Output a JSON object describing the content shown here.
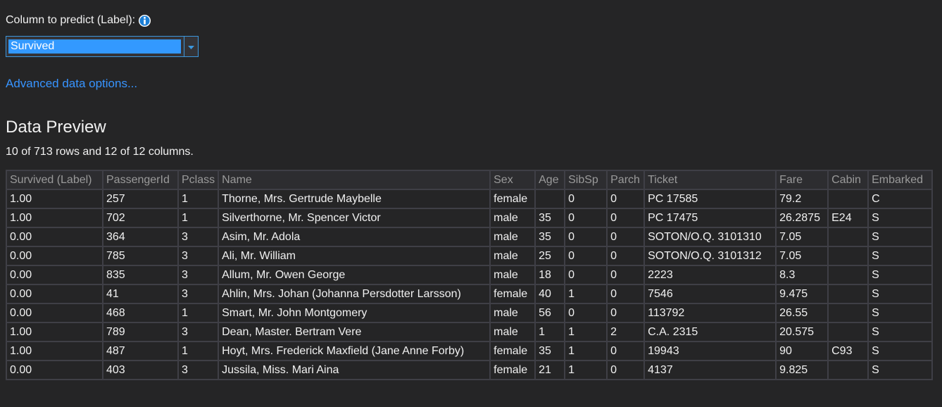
{
  "label_section": {
    "text": "Column to predict (Label):",
    "info_icon": "info-icon"
  },
  "label_dropdown": {
    "selected": "Survived",
    "arrow_icon": "chevron-down-icon"
  },
  "advanced_link": "Advanced data options...",
  "preview": {
    "title": "Data Preview",
    "summary": "10 of 713 rows and 12 of 12 columns.",
    "columns": [
      "Survived (Label)",
      "PassengerId",
      "Pclass",
      "Name",
      "Sex",
      "Age",
      "SibSp",
      "Parch",
      "Ticket",
      "Fare",
      "Cabin",
      "Embarked"
    ],
    "rows": [
      [
        "1.00",
        "257",
        "1",
        "Thorne, Mrs. Gertrude Maybelle",
        "female",
        "",
        "0",
        "0",
        "PC 17585",
        "79.2",
        "",
        "C"
      ],
      [
        "1.00",
        "702",
        "1",
        "Silverthorne, Mr. Spencer Victor",
        "male",
        "35",
        "0",
        "0",
        "PC 17475",
        "26.2875",
        "E24",
        "S"
      ],
      [
        "0.00",
        "364",
        "3",
        "Asim, Mr. Adola",
        "male",
        "35",
        "0",
        "0",
        "SOTON/O.Q. 3101310",
        "7.05",
        "",
        "S"
      ],
      [
        "0.00",
        "785",
        "3",
        "Ali, Mr. William",
        "male",
        "25",
        "0",
        "0",
        "SOTON/O.Q. 3101312",
        "7.05",
        "",
        "S"
      ],
      [
        "0.00",
        "835",
        "3",
        "Allum, Mr. Owen George",
        "male",
        "18",
        "0",
        "0",
        "2223",
        "8.3",
        "",
        "S"
      ],
      [
        "0.00",
        "41",
        "3",
        "Ahlin, Mrs. Johan (Johanna Persdotter Larsson)",
        "female",
        "40",
        "1",
        "0",
        "7546",
        "9.475",
        "",
        "S"
      ],
      [
        "0.00",
        "468",
        "1",
        "Smart, Mr. John Montgomery",
        "male",
        "56",
        "0",
        "0",
        "113792",
        "26.55",
        "",
        "S"
      ],
      [
        "1.00",
        "789",
        "3",
        "Dean, Master. Bertram Vere",
        "male",
        "1",
        "1",
        "2",
        "C.A. 2315",
        "20.575",
        "",
        "S"
      ],
      [
        "1.00",
        "487",
        "1",
        "Hoyt, Mrs. Frederick Maxfield (Jane Anne Forby)",
        "female",
        "35",
        "1",
        "0",
        "19943",
        "90",
        "C93",
        "S"
      ],
      [
        "0.00",
        "403",
        "3",
        "Jussila, Miss. Mari Aina",
        "female",
        "21",
        "1",
        "0",
        "4137",
        "9.825",
        "",
        "S"
      ]
    ]
  },
  "colors": {
    "background": "#252526",
    "accent": "#3794ff",
    "selection": "#3399ff",
    "grid_border": "#3f3f46"
  }
}
